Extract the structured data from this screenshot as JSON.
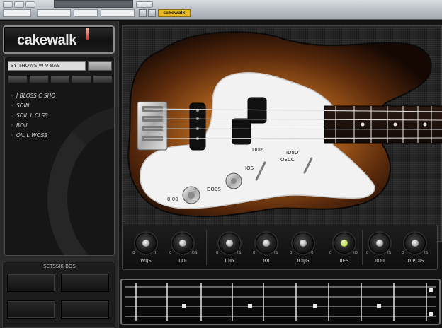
{
  "topbar": {
    "buttons": [
      "",
      "",
      "",
      "",
      "",
      "",
      "",
      ""
    ],
    "preset_tag": "cakewalk"
  },
  "logo": {
    "text": "cakewalk"
  },
  "browser": {
    "header": "SY THOWS W V BAS",
    "items": [
      "J BLOSS C SHO",
      "SOIN",
      "SOIL L CLSS",
      "BOIL",
      "OIL L WOSS"
    ]
  },
  "bottom_left": {
    "label": "SETSSIK BOS"
  },
  "bass": {
    "pickguard_labels": [
      "D0I6",
      "ID8O",
      "OSCC",
      "IOS",
      "DO0S",
      "0:00"
    ]
  },
  "controls": {
    "knobs": [
      {
        "label": "WIJS"
      },
      {
        "label": "IIOI"
      },
      {
        "label": "I0I6"
      },
      {
        "label": "I0I"
      },
      {
        "label": "IOIJG"
      },
      {
        "label": "IIES"
      },
      {
        "label": "IIOII"
      },
      {
        "label": "I0 POIS"
      }
    ],
    "marks": [
      "0",
      "II",
      "0",
      "IOS",
      "0",
      "IS",
      "0",
      "IS",
      "0",
      "0",
      "0",
      "IO",
      "0",
      "IS",
      "0",
      "IS"
    ]
  },
  "colors": {
    "sunburst_center": "#c07a2a",
    "sunburst_edge": "#1a0c05",
    "pickguard": "#f2f2f2",
    "led": "#b6d84a",
    "preset_tag": "#e8b92a"
  },
  "icons": [
    "bass-guitar-image",
    "knob-icon",
    "led-indicator-icon",
    "mini-fretboard"
  ]
}
